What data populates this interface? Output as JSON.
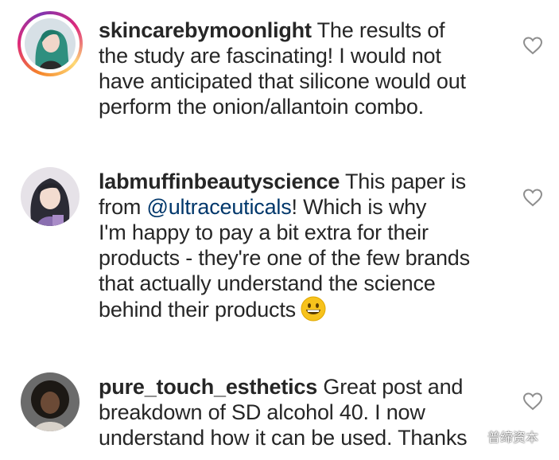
{
  "comments": [
    {
      "username": "skincarebymoonlight",
      "text_parts": [
        "The results of\nthe study are fascinating! I would not\nhave anticipated that silicone would out\nperform the onion/allantoin combo."
      ]
    },
    {
      "username": "labmuffinbeautyscience",
      "text_before": "This paper is\nfrom ",
      "mention": "@ultraceuticals",
      "text_after": "! Which is why\nI'm happy to pay a bit extra for their\nproducts - they're one of the few brands\nthat actually understand the science\nbehind their products",
      "emoji": "grinning-face-emoji"
    },
    {
      "username": "pure_touch_esthetics",
      "text_parts": [
        "Great post and\nbreakdown of SD alcohol 40. I now\nunderstand how it can be used. Thanks"
      ]
    }
  ],
  "watermark": {
    "text": "普缔资本",
    "icon": "wechat-logo-icon"
  },
  "icons": {
    "like": "heart-outline-icon"
  },
  "colors": {
    "text": "#262626",
    "mention": "#00376b",
    "heart": "#8e8e8e"
  }
}
